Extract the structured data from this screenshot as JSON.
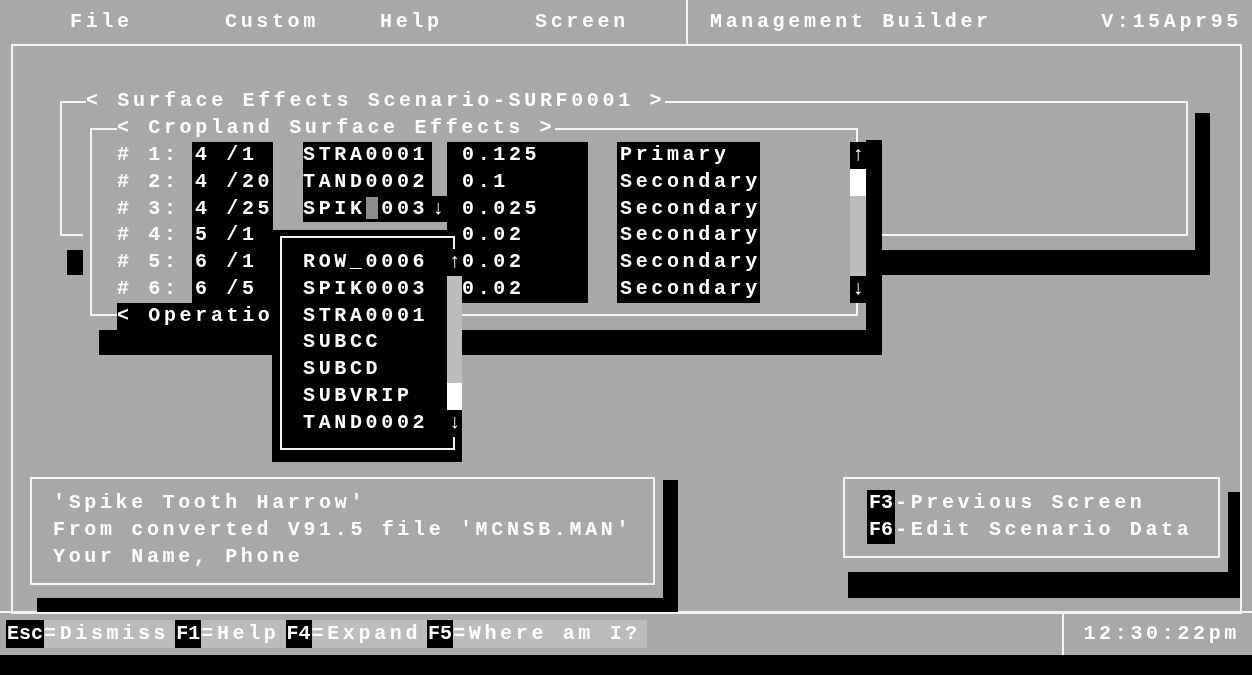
{
  "menu_bar": {
    "items": [
      "File",
      "Custom",
      "Help",
      "Screen"
    ],
    "title": "Management Builder",
    "version": "V:15Apr95"
  },
  "scenario_window": {
    "title": "< Surface Effects Scenario-SURF0001 >"
  },
  "cropland_window": {
    "title": "< Cropland Surface Effects >",
    "scroll_up": "↑",
    "scroll_down": "↓",
    "rows": [
      {
        "number": "# 1:",
        "date": "4 /1",
        "operation": "STRA0001",
        "cursor": false,
        "value": "0.125",
        "type": "Primary"
      },
      {
        "number": "# 2:",
        "date": "4 /20",
        "operation": "TAND0002",
        "cursor": false,
        "value": "0.1",
        "type": "Secondary"
      },
      {
        "number": "# 3:",
        "date": "4 /25",
        "operation": "SPIK",
        "cursor": true,
        "operation_rest": "003",
        "dropdown_arrow": "↓",
        "value": "0.025",
        "type": "Secondary"
      },
      {
        "number": "# 4:",
        "date": "5 /1",
        "value": "0.02",
        "type": "Secondary"
      },
      {
        "number": "# 5:",
        "date": "6 /1",
        "value": "0.02",
        "type": "Secondary"
      },
      {
        "number": "# 6:",
        "date": "6 /5",
        "value": "0.02",
        "type": "Secondary"
      }
    ]
  },
  "operations_window": {
    "title": "< Operatio"
  },
  "operation_dropdown": {
    "items": [
      "ROW_0006",
      "SPIK0003",
      "STRA0001",
      "SUBCC",
      "SUBCD",
      "SUBVRIP",
      "TAND0002"
    ],
    "scroll_up": "↑",
    "scroll_down": "↓"
  },
  "description_box": {
    "lines": [
      "'Spike Tooth Harrow'",
      "From converted V91.5 file 'MCNSB.MAN'",
      "Your Name, Phone"
    ]
  },
  "key_hints": [
    {
      "key": "F3",
      "label": "-Previous Screen"
    },
    {
      "key": "F6",
      "label": "-Edit Scenario Data"
    }
  ],
  "status_bar": {
    "keys": [
      {
        "key": "Esc",
        "label": "=Dismiss"
      },
      {
        "key": "F1",
        "label": "=Help"
      },
      {
        "key": "F4",
        "label": "=Expand"
      },
      {
        "key": "F5",
        "label": "=Where am I?"
      }
    ],
    "time": "12:30:22pm"
  }
}
